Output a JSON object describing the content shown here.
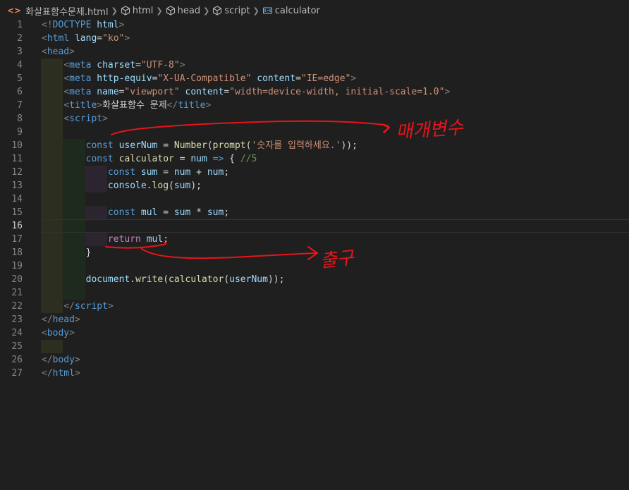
{
  "breadcrumb": {
    "file": "화살표함수문제.html",
    "items": [
      "html",
      "head",
      "script",
      "calculator"
    ]
  },
  "current_line": 16,
  "lines": [
    {
      "n": "1",
      "tokens": [
        [
          "t-br",
          "<!"
        ],
        [
          "t-tag",
          "DOCTYPE"
        ],
        [
          "t-txt",
          " "
        ],
        [
          "t-attr",
          "html"
        ],
        [
          "t-br",
          ">"
        ]
      ]
    },
    {
      "n": "2",
      "tokens": [
        [
          "t-br",
          "<"
        ],
        [
          "t-tag",
          "html"
        ],
        [
          "t-txt",
          " "
        ],
        [
          "t-attr",
          "lang"
        ],
        [
          "t-txt",
          "="
        ],
        [
          "t-str",
          "\"ko\""
        ],
        [
          "t-br",
          ">"
        ]
      ]
    },
    {
      "n": "3",
      "tokens": [
        [
          "t-br",
          "<"
        ],
        [
          "t-tag",
          "head"
        ],
        [
          "t-br",
          ">"
        ]
      ]
    },
    {
      "n": "4",
      "tokens": [
        [
          "t-txt",
          "    "
        ],
        [
          "t-br",
          "<"
        ],
        [
          "t-tag",
          "meta"
        ],
        [
          "t-txt",
          " "
        ],
        [
          "t-attr",
          "charset"
        ],
        [
          "t-txt",
          "="
        ],
        [
          "t-str",
          "\"UTF-8\""
        ],
        [
          "t-br",
          ">"
        ]
      ]
    },
    {
      "n": "5",
      "tokens": [
        [
          "t-txt",
          "    "
        ],
        [
          "t-br",
          "<"
        ],
        [
          "t-tag",
          "meta"
        ],
        [
          "t-txt",
          " "
        ],
        [
          "t-attr",
          "http-equiv"
        ],
        [
          "t-txt",
          "="
        ],
        [
          "t-str",
          "\"X-UA-Compatible\""
        ],
        [
          "t-txt",
          " "
        ],
        [
          "t-attr",
          "content"
        ],
        [
          "t-txt",
          "="
        ],
        [
          "t-str",
          "\"IE=edge\""
        ],
        [
          "t-br",
          ">"
        ]
      ]
    },
    {
      "n": "6",
      "tokens": [
        [
          "t-txt",
          "    "
        ],
        [
          "t-br",
          "<"
        ],
        [
          "t-tag",
          "meta"
        ],
        [
          "t-txt",
          " "
        ],
        [
          "t-attr",
          "name"
        ],
        [
          "t-txt",
          "="
        ],
        [
          "t-str",
          "\"viewport\""
        ],
        [
          "t-txt",
          " "
        ],
        [
          "t-attr",
          "content"
        ],
        [
          "t-txt",
          "="
        ],
        [
          "t-str",
          "\"width=device-width, initial-scale=1.0\""
        ],
        [
          "t-br",
          ">"
        ]
      ]
    },
    {
      "n": "7",
      "tokens": [
        [
          "t-txt",
          "    "
        ],
        [
          "t-br",
          "<"
        ],
        [
          "t-tag",
          "title"
        ],
        [
          "t-br",
          ">"
        ],
        [
          "t-txt",
          "화살표함수 문제"
        ],
        [
          "t-br",
          "</"
        ],
        [
          "t-tag",
          "title"
        ],
        [
          "t-br",
          ">"
        ]
      ]
    },
    {
      "n": "8",
      "tokens": [
        [
          "t-txt",
          "    "
        ],
        [
          "t-br",
          "<"
        ],
        [
          "t-tag",
          "script"
        ],
        [
          "t-br",
          ">"
        ]
      ]
    },
    {
      "n": "9",
      "tokens": []
    },
    {
      "n": "10",
      "tokens": [
        [
          "t-txt",
          "        "
        ],
        [
          "t-kw",
          "const"
        ],
        [
          "t-txt",
          " "
        ],
        [
          "t-var",
          "userNum"
        ],
        [
          "t-txt",
          " = "
        ],
        [
          "t-fn",
          "Number"
        ],
        [
          "t-txt",
          "("
        ],
        [
          "t-fn",
          "prompt"
        ],
        [
          "t-txt",
          "("
        ],
        [
          "t-str",
          "'숫자를 입력하세요.'"
        ],
        [
          "t-txt",
          "));"
        ]
      ]
    },
    {
      "n": "11",
      "tokens": [
        [
          "t-txt",
          "        "
        ],
        [
          "t-kw",
          "const"
        ],
        [
          "t-txt",
          " "
        ],
        [
          "t-fn",
          "calculator"
        ],
        [
          "t-txt",
          " = "
        ],
        [
          "t-var",
          "num"
        ],
        [
          "t-txt",
          " "
        ],
        [
          "t-kw",
          "=>"
        ],
        [
          "t-txt",
          " { "
        ],
        [
          "t-cmt",
          "//5"
        ]
      ]
    },
    {
      "n": "12",
      "tokens": [
        [
          "t-txt",
          "            "
        ],
        [
          "t-kw",
          "const"
        ],
        [
          "t-txt",
          " "
        ],
        [
          "t-var",
          "sum"
        ],
        [
          "t-txt",
          " = "
        ],
        [
          "t-var",
          "num"
        ],
        [
          "t-txt",
          " + "
        ],
        [
          "t-var",
          "num"
        ],
        [
          "t-txt",
          ";"
        ]
      ]
    },
    {
      "n": "13",
      "tokens": [
        [
          "t-txt",
          "            "
        ],
        [
          "t-var",
          "console"
        ],
        [
          "t-txt",
          "."
        ],
        [
          "t-fn",
          "log"
        ],
        [
          "t-txt",
          "("
        ],
        [
          "t-var",
          "sum"
        ],
        [
          "t-txt",
          ");"
        ]
      ]
    },
    {
      "n": "14",
      "tokens": []
    },
    {
      "n": "15",
      "tokens": [
        [
          "t-txt",
          "            "
        ],
        [
          "t-kw",
          "const"
        ],
        [
          "t-txt",
          " "
        ],
        [
          "t-var",
          "mul"
        ],
        [
          "t-txt",
          " = "
        ],
        [
          "t-var",
          "sum"
        ],
        [
          "t-txt",
          " * "
        ],
        [
          "t-var",
          "sum"
        ],
        [
          "t-txt",
          ";"
        ]
      ]
    },
    {
      "n": "16",
      "tokens": []
    },
    {
      "n": "17",
      "tokens": [
        [
          "t-txt",
          "            "
        ],
        [
          "t-ret",
          "return"
        ],
        [
          "t-txt",
          " "
        ],
        [
          "t-var",
          "mul"
        ],
        [
          "t-txt",
          ";"
        ]
      ]
    },
    {
      "n": "18",
      "tokens": [
        [
          "t-txt",
          "        }"
        ]
      ]
    },
    {
      "n": "19",
      "tokens": []
    },
    {
      "n": "20",
      "tokens": [
        [
          "t-txt",
          "        "
        ],
        [
          "t-var",
          "document"
        ],
        [
          "t-txt",
          "."
        ],
        [
          "t-fn",
          "write"
        ],
        [
          "t-txt",
          "("
        ],
        [
          "t-fn",
          "calculator"
        ],
        [
          "t-txt",
          "("
        ],
        [
          "t-var",
          "userNum"
        ],
        [
          "t-txt",
          "));"
        ]
      ]
    },
    {
      "n": "21",
      "tokens": []
    },
    {
      "n": "22",
      "tokens": [
        [
          "t-txt",
          "    "
        ],
        [
          "t-br",
          "</"
        ],
        [
          "t-tag",
          "script"
        ],
        [
          "t-br",
          ">"
        ]
      ]
    },
    {
      "n": "23",
      "tokens": [
        [
          "t-br",
          "</"
        ],
        [
          "t-tag",
          "head"
        ],
        [
          "t-br",
          ">"
        ]
      ]
    },
    {
      "n": "24",
      "tokens": [
        [
          "t-br",
          "<"
        ],
        [
          "t-tag",
          "body"
        ],
        [
          "t-br",
          ">"
        ]
      ]
    },
    {
      "n": "25",
      "tokens": []
    },
    {
      "n": "26",
      "tokens": [
        [
          "t-br",
          "</"
        ],
        [
          "t-tag",
          "body"
        ],
        [
          "t-br",
          ">"
        ]
      ]
    },
    {
      "n": "27",
      "tokens": [
        [
          "t-br",
          "</"
        ],
        [
          "t-tag",
          "html"
        ],
        [
          "t-br",
          ">"
        ]
      ]
    }
  ],
  "annotations": {
    "ink_color": "#e8141a",
    "note_top": "매개변수",
    "note_bottom": "출구"
  }
}
